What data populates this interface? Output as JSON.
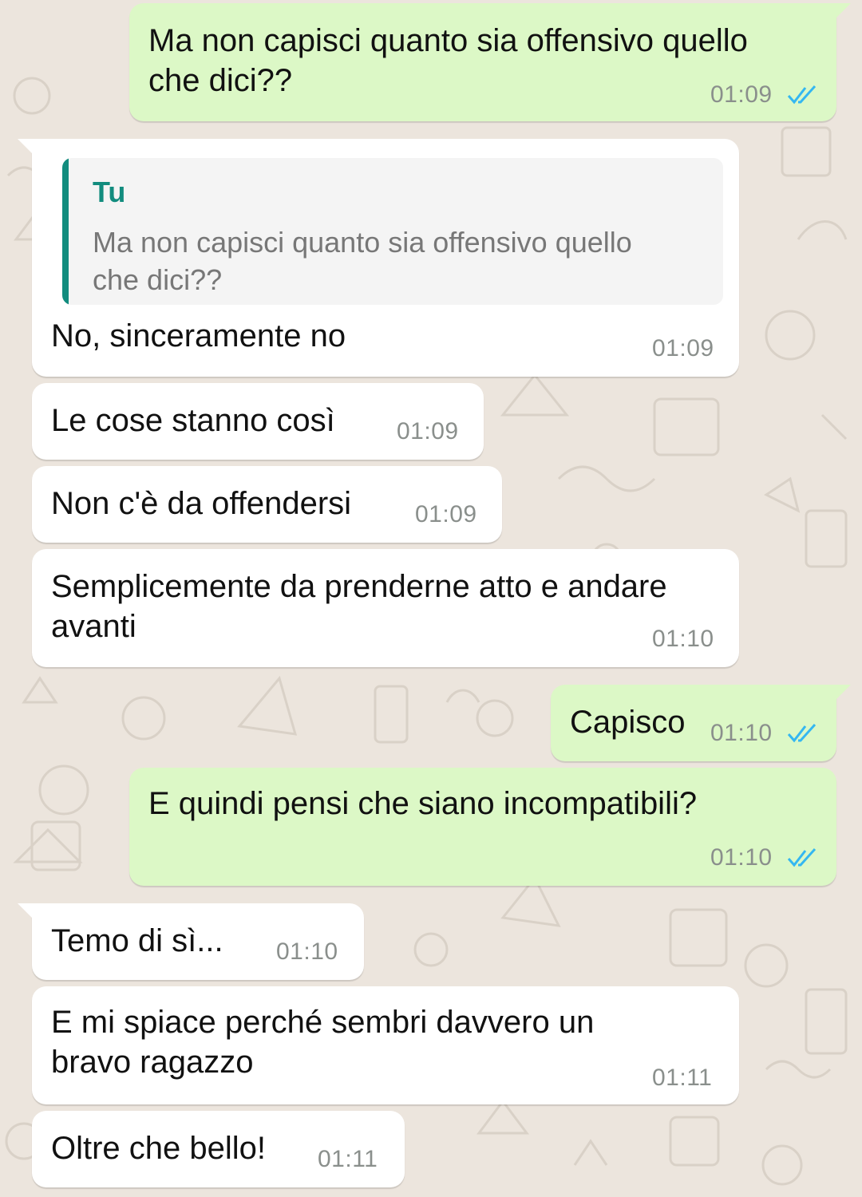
{
  "colors": {
    "outgoing_bubble": "#dcf8c6",
    "incoming_bubble": "#ffffff",
    "background": "#ece5dd",
    "read_ticks": "#34b7f1",
    "quote_accent": "#128c7e"
  },
  "messages": [
    {
      "direction": "out",
      "text": "Ma non capisci quanto sia offensivo quello\nche dici??",
      "time": "01:09",
      "status": "read",
      "status_icon": "double-check-icon"
    },
    {
      "direction": "in",
      "quote": {
        "author": "Tu",
        "text": "Ma non capisci quanto sia offensivo quello che dici??"
      },
      "text": "No, sinceramente no",
      "time": "01:09"
    },
    {
      "direction": "in",
      "text": "Le cose stanno così",
      "time": "01:09"
    },
    {
      "direction": "in",
      "text": "Non c'è da offendersi",
      "time": "01:09"
    },
    {
      "direction": "in",
      "text": "Semplicemente da prenderne atto e andare\navanti",
      "time": "01:10"
    },
    {
      "direction": "out",
      "text": "Capisco",
      "time": "01:10",
      "status": "read",
      "status_icon": "double-check-icon"
    },
    {
      "direction": "out",
      "text": "E quindi pensi che siano incompatibili?",
      "time": "01:10",
      "status": "read",
      "status_icon": "double-check-icon"
    },
    {
      "direction": "in",
      "text": "Temo di sì...",
      "time": "01:10"
    },
    {
      "direction": "in",
      "text": "E mi spiace perché sembri davvero un\nbravo ragazzo",
      "time": "01:11"
    },
    {
      "direction": "in",
      "text": "Oltre che bello!",
      "time": "01:11"
    }
  ]
}
